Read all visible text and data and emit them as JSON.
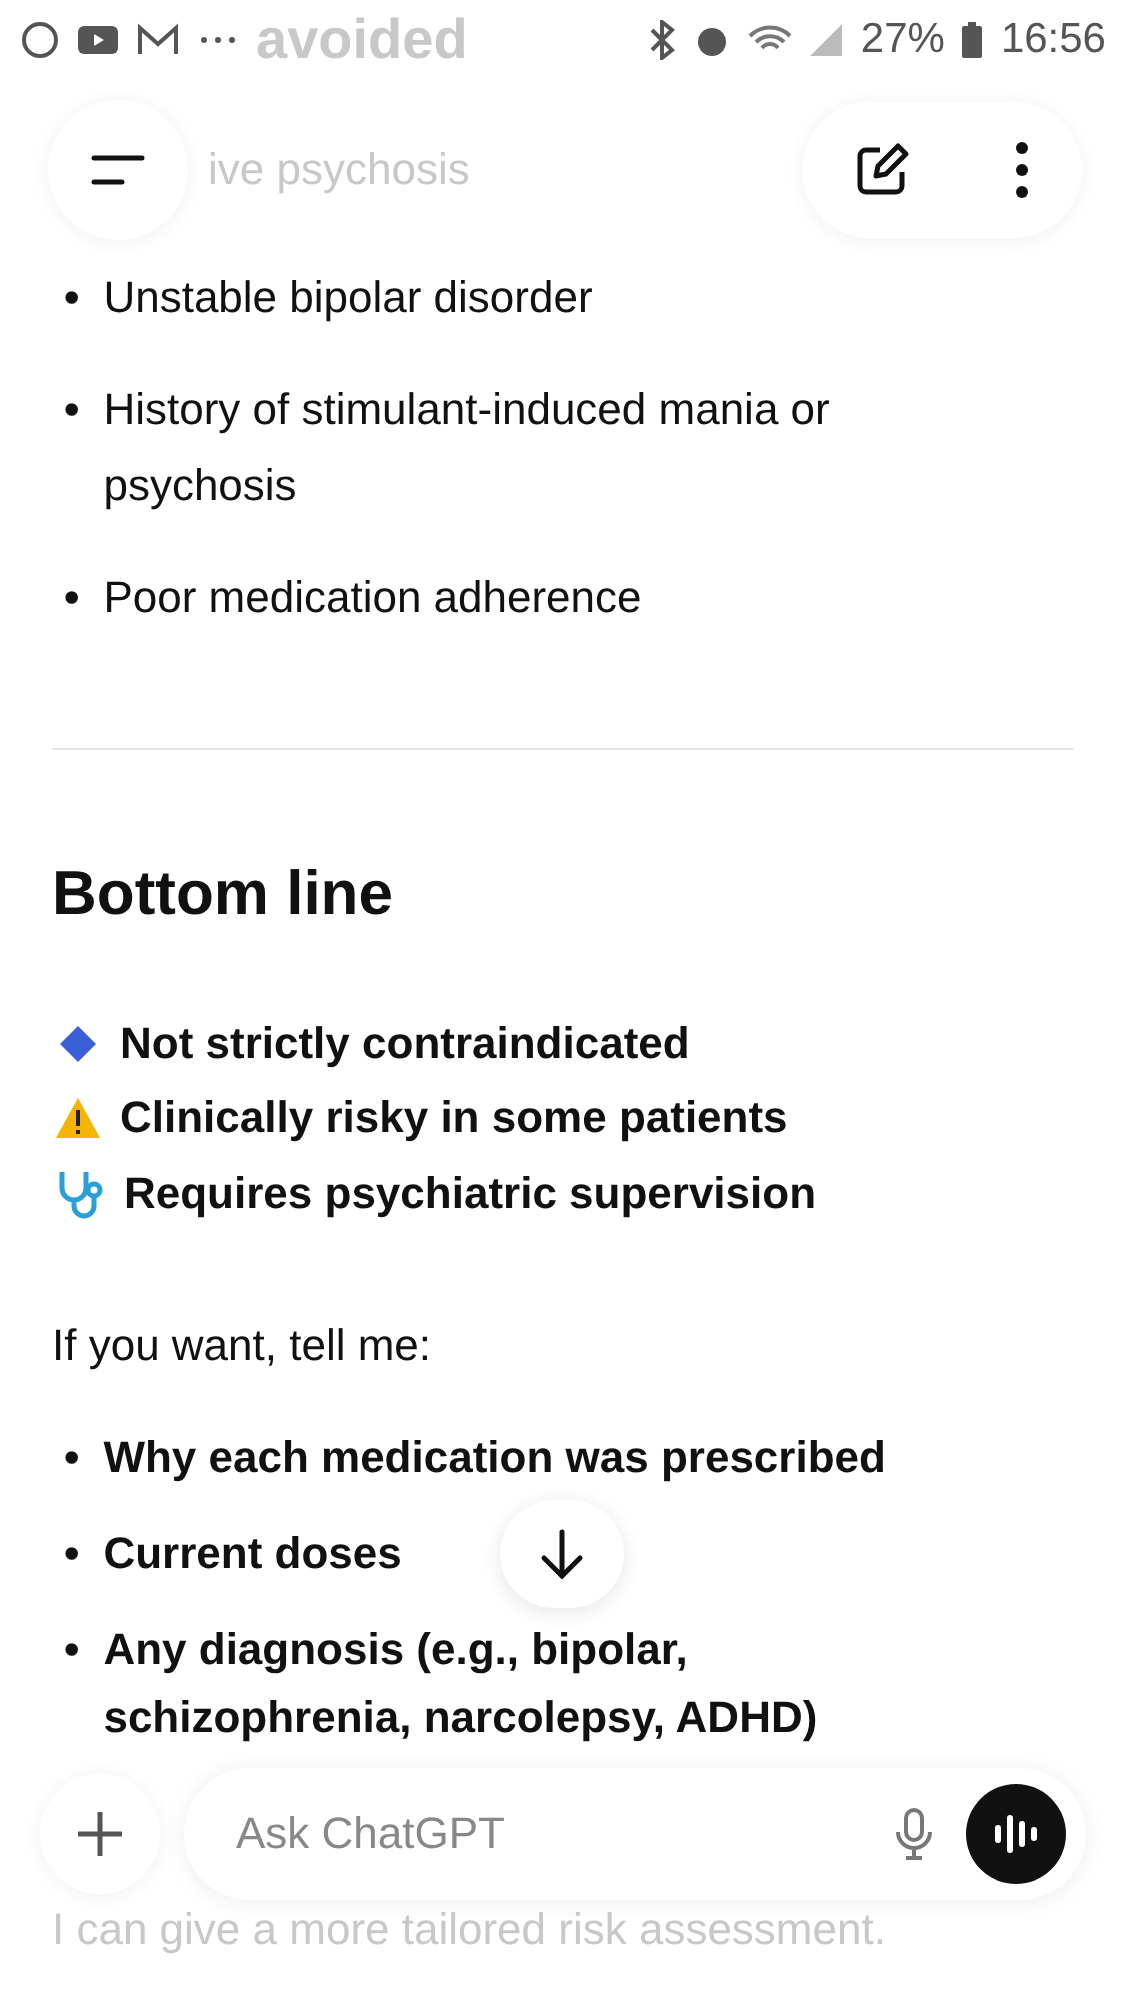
{
  "status_bar": {
    "faded_text": "avoided",
    "battery": "27%",
    "time": "16:56"
  },
  "header": {
    "faded_text": "ive psychosis"
  },
  "risk_bullets": [
    {
      "marker": "•",
      "text": "Unstable bipolar disorder"
    },
    {
      "marker": "•",
      "text": "History of stimulant-induced mania or psychosis"
    },
    {
      "marker": "•",
      "text": "Poor medication adherence"
    }
  ],
  "heading": "Bottom line",
  "summary": [
    {
      "kind": "diamond",
      "text": "Not strictly contraindicated"
    },
    {
      "kind": "warning",
      "text": "Clinically risky in some patients"
    },
    {
      "kind": "stethoscope",
      "text": "Requires psychiatric supervision"
    }
  ],
  "prompt": "If you want, tell me:",
  "requests": [
    {
      "marker": "•",
      "text": "Why each medication was prescribed"
    },
    {
      "marker": "•",
      "text": "Current doses"
    },
    {
      "marker": "•",
      "text": "Any diagnosis (e.g., bipolar, schizophrenia, narcolepsy, ADHD)"
    }
  ],
  "composer": {
    "placeholder": "Ask ChatGPT"
  },
  "footer_text": "I can give a more tailored risk assessment."
}
